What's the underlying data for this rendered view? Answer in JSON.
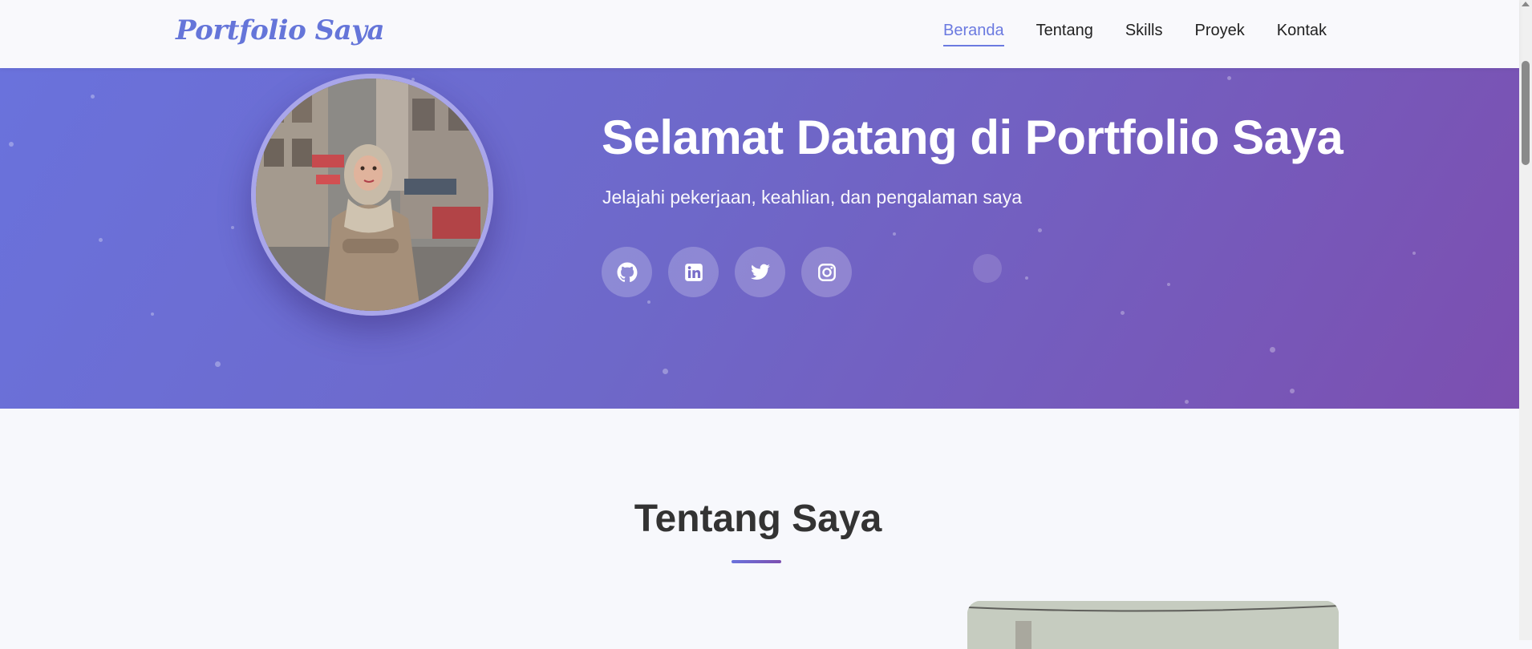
{
  "navbar": {
    "logo": "Portfolio Saya",
    "items": [
      {
        "label": "Beranda",
        "active": true
      },
      {
        "label": "Tentang",
        "active": false
      },
      {
        "label": "Skills",
        "active": false
      },
      {
        "label": "Proyek",
        "active": false
      },
      {
        "label": "Kontak",
        "active": false
      }
    ]
  },
  "hero": {
    "title": "Selamat Datang di Portfolio Saya",
    "subtitle": "Jelajahi pekerjaan, keahlian, dan pengalaman saya",
    "socials": [
      {
        "icon": "github-icon"
      },
      {
        "icon": "linkedin-icon"
      },
      {
        "icon": "twitter-icon"
      },
      {
        "icon": "instagram-icon"
      }
    ]
  },
  "about": {
    "title": "Tentang Saya"
  },
  "colors": {
    "accent": "#6b7ae0",
    "hero_start": "#6a72dc",
    "hero_end": "#7c4fb0"
  }
}
